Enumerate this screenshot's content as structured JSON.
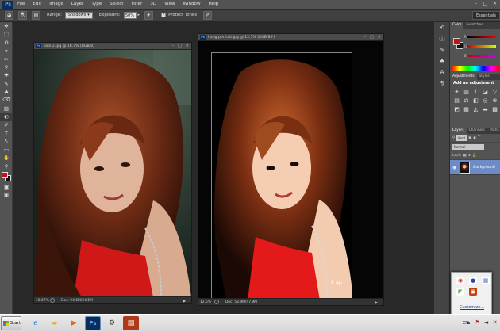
{
  "menubar": {
    "logo": "Ps",
    "items": [
      "File",
      "Edit",
      "Image",
      "Layer",
      "Type",
      "Select",
      "Filter",
      "3D",
      "View",
      "Window",
      "Help"
    ],
    "win_buttons": [
      "–",
      "□",
      "✕"
    ]
  },
  "options": {
    "brush_size": "65",
    "range_label": "Range:",
    "range_value": "Shadows",
    "exposure_label": "Exposure:",
    "exposure_value": "50%",
    "protect_tones_label": "Protect Tones",
    "protect_tones_checked": true,
    "workspace": "Essentials"
  },
  "tools": [
    "✥",
    "⬚",
    "ʘ",
    "⌖",
    "✂",
    "⚲",
    "✚",
    "✎",
    "♣",
    "⌫",
    "▨",
    "◐",
    "✐",
    "T",
    "↖",
    "▭",
    "✋",
    "⚲"
  ],
  "doc1": {
    "title": "kool 2.jpg @ 16.7% (RGB/8)",
    "zoom": "16.67%",
    "doc_size": "Doc: 24.6M/24.6M"
  },
  "doc2": {
    "title": "hang portrait.jpg @ 12.5% (RGB/8#)",
    "zoom": "12.5%",
    "doc_size": "Doc: 53.9M/47.9M",
    "signature_text": "8 Ap"
  },
  "panels": {
    "color_tabs": [
      "Color",
      "Swatches"
    ],
    "adjust_tabs": [
      "Adjustments",
      "Styles"
    ],
    "add_adjustment": "Add an adjustment",
    "layers_tabs": [
      "Layers",
      "Channels",
      "Paths"
    ],
    "kind_label": "Kind",
    "blend_mode": "Normal",
    "lock_label": "Lock:",
    "layer_name": "Background",
    "colors": {
      "fg": "#c81010",
      "bg": "#111111"
    }
  },
  "tray_popup": {
    "customize": "Customize..."
  },
  "taskbar": {
    "start": "Start",
    "apps": [
      "ie-icon",
      "folder-icon",
      "media-icon",
      "photoshop-icon",
      "utility-icon",
      "zip-icon"
    ],
    "ps_label": "Ps",
    "lang": "EN"
  }
}
